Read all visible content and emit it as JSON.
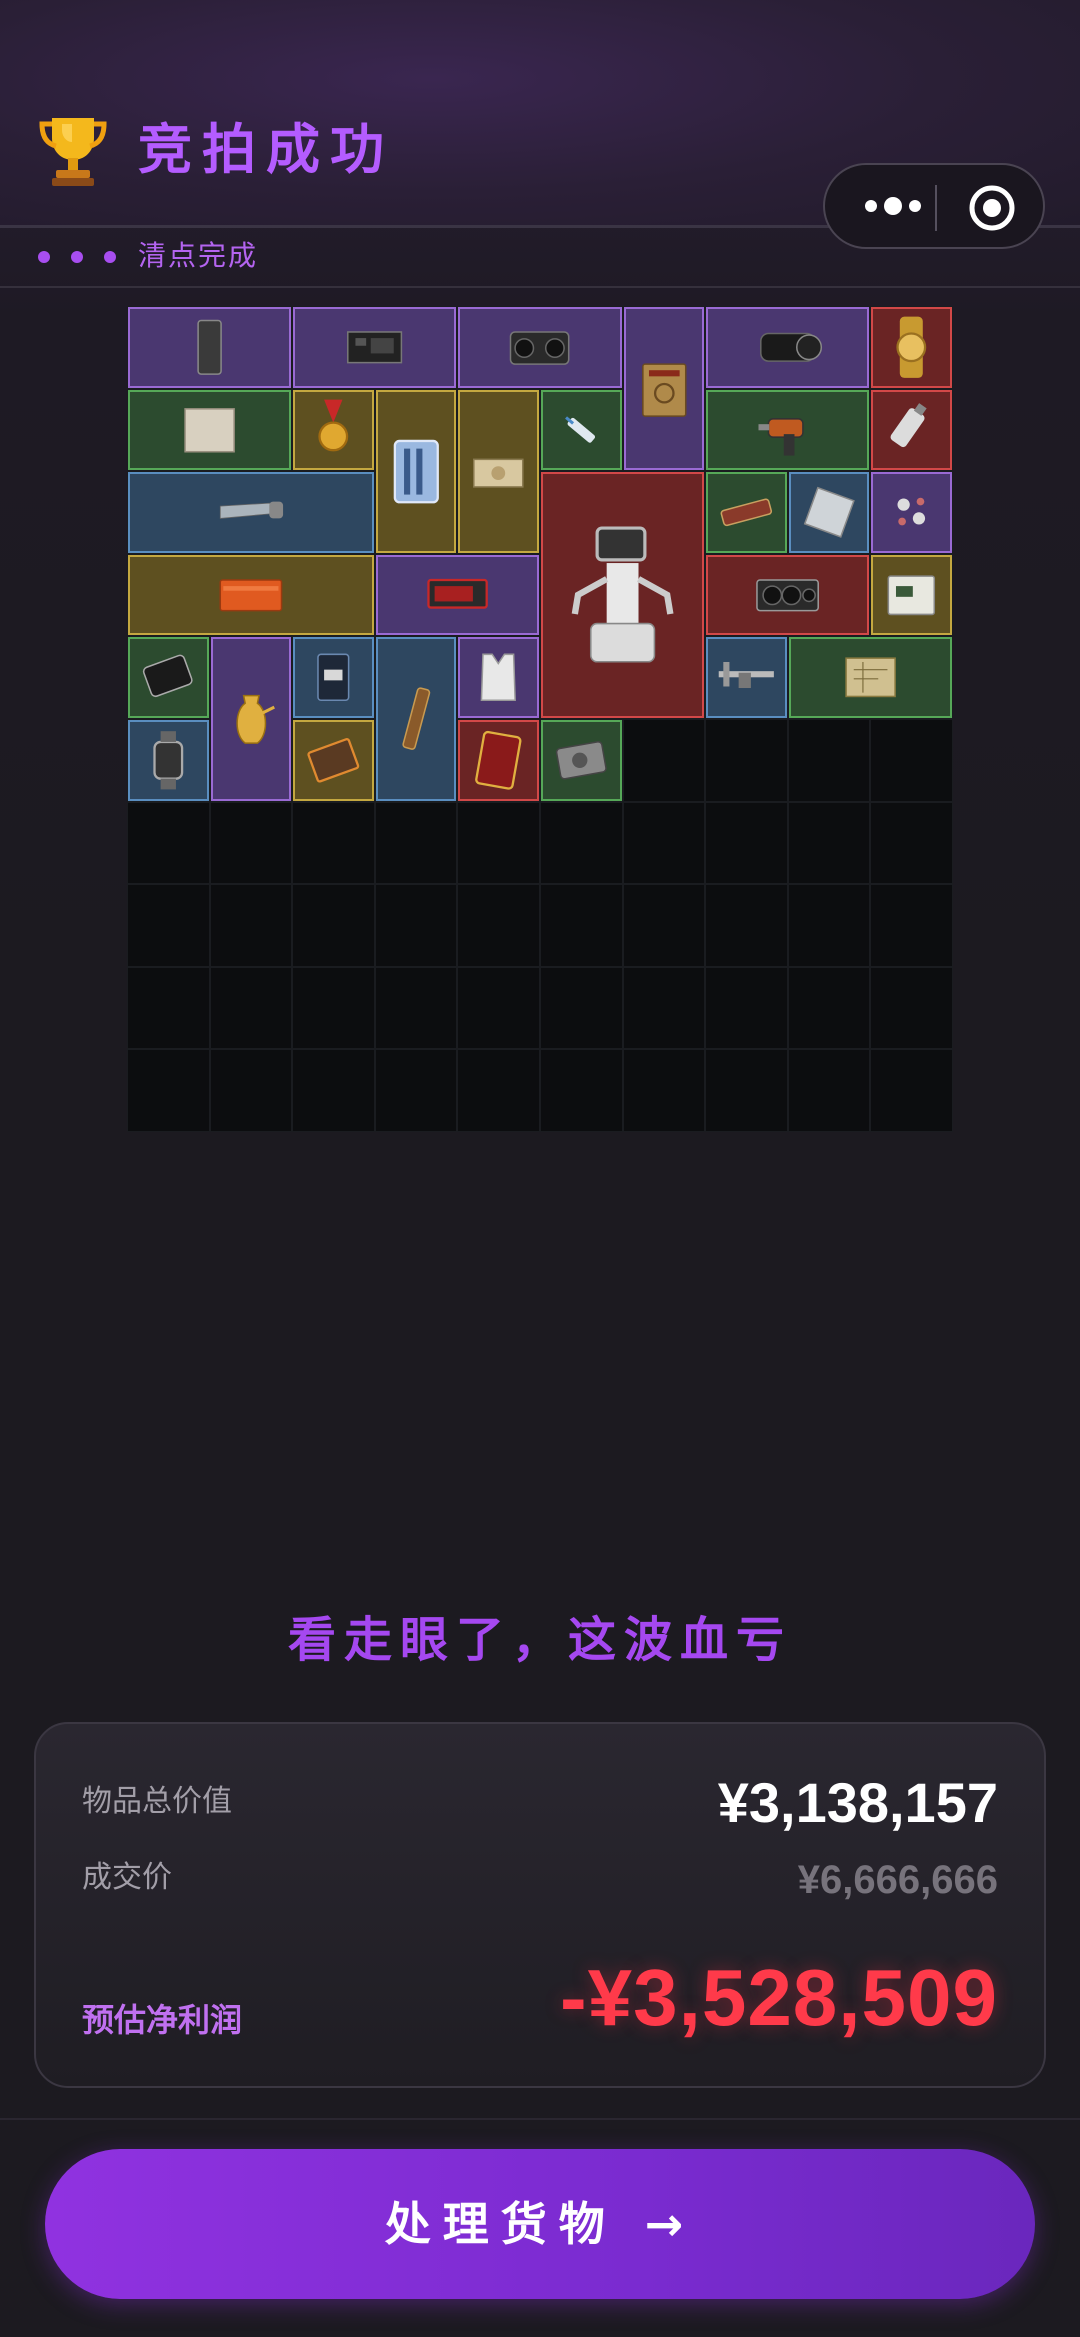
{
  "header": {
    "title": "竞拍成功",
    "status_label": "清点完成"
  },
  "verdict": "看走眼了，这波血亏",
  "summary": {
    "total_label": "物品总价值",
    "total_value": "¥3,138,157",
    "deal_label": "成交价",
    "deal_value": "¥6,666,666",
    "profit_label": "预估净利润",
    "profit_value": "-¥3,528,509"
  },
  "action_button": {
    "label": "处理货物 →"
  },
  "grid": {
    "columns": 10,
    "rows": 10,
    "items": [
      {
        "name": "slate-item",
        "rarity": "purple",
        "col": 0,
        "row": 0,
        "w": 2,
        "h": 1
      },
      {
        "name": "circuit-board-item",
        "rarity": "purple",
        "col": 2,
        "row": 0,
        "w": 2,
        "h": 1
      },
      {
        "name": "boombox-item",
        "rarity": "purple",
        "col": 4,
        "row": 0,
        "w": 2,
        "h": 1
      },
      {
        "name": "manual-book-item",
        "rarity": "purple",
        "col": 6,
        "row": 0,
        "w": 1,
        "h": 2
      },
      {
        "name": "camera-lens-item",
        "rarity": "purple",
        "col": 7,
        "row": 0,
        "w": 2,
        "h": 1
      },
      {
        "name": "gold-watch-item",
        "rarity": "red",
        "col": 9,
        "row": 0,
        "w": 1,
        "h": 1
      },
      {
        "name": "paper-sheet-item",
        "rarity": "green",
        "col": 0,
        "row": 1,
        "w": 2,
        "h": 1
      },
      {
        "name": "medal-item",
        "rarity": "gold",
        "col": 2,
        "row": 1,
        "w": 1,
        "h": 1
      },
      {
        "name": "tool-case-item",
        "rarity": "gold",
        "col": 3,
        "row": 1,
        "w": 1,
        "h": 2
      },
      {
        "name": "banknotes-item",
        "rarity": "gold",
        "col": 4,
        "row": 1,
        "w": 1,
        "h": 2
      },
      {
        "name": "syringe-item",
        "rarity": "green",
        "col": 5,
        "row": 1,
        "w": 1,
        "h": 1
      },
      {
        "name": "power-drill-item",
        "rarity": "green",
        "col": 7,
        "row": 1,
        "w": 2,
        "h": 1
      },
      {
        "name": "usb-drive-item",
        "rarity": "red",
        "col": 9,
        "row": 1,
        "w": 1,
        "h": 1
      },
      {
        "name": "saw-item",
        "rarity": "blue",
        "col": 0,
        "row": 2,
        "w": 3,
        "h": 1
      },
      {
        "name": "robot-item",
        "rarity": "red",
        "col": 5,
        "row": 2,
        "w": 2,
        "h": 3
      },
      {
        "name": "snack-bar-item",
        "rarity": "green",
        "col": 7,
        "row": 2,
        "w": 1,
        "h": 1
      },
      {
        "name": "cpu-chip-item",
        "rarity": "blue",
        "col": 8,
        "row": 2,
        "w": 1,
        "h": 1
      },
      {
        "name": "earrings-item",
        "rarity": "purple",
        "col": 9,
        "row": 2,
        "w": 1,
        "h": 1
      },
      {
        "name": "orange-crate-item",
        "rarity": "gold",
        "col": 0,
        "row": 3,
        "w": 3,
        "h": 1
      },
      {
        "name": "red-gpu-item",
        "rarity": "purple",
        "col": 3,
        "row": 3,
        "w": 2,
        "h": 1
      },
      {
        "name": "graphics-card-item",
        "rarity": "red",
        "col": 7,
        "row": 3,
        "w": 2,
        "h": 1
      },
      {
        "name": "plc-module-item",
        "rarity": "gold",
        "col": 9,
        "row": 3,
        "w": 1,
        "h": 1
      },
      {
        "name": "hard-drive-item",
        "rarity": "green",
        "col": 0,
        "row": 4,
        "w": 1,
        "h": 1
      },
      {
        "name": "golden-ewer-item",
        "rarity": "purple",
        "col": 1,
        "row": 4,
        "w": 1,
        "h": 2
      },
      {
        "name": "coffee-bag-item",
        "rarity": "blue",
        "col": 2,
        "row": 4,
        "w": 1,
        "h": 1
      },
      {
        "name": "spyglass-item",
        "rarity": "blue",
        "col": 3,
        "row": 4,
        "w": 1,
        "h": 2
      },
      {
        "name": "vest-item",
        "rarity": "purple",
        "col": 4,
        "row": 4,
        "w": 1,
        "h": 1
      },
      {
        "name": "caliper-item",
        "rarity": "blue",
        "col": 7,
        "row": 4,
        "w": 1,
        "h": 1
      },
      {
        "name": "blueprint-item",
        "rarity": "green",
        "col": 8,
        "row": 4,
        "w": 2,
        "h": 1
      },
      {
        "name": "smartwatch-item",
        "rarity": "blue",
        "col": 0,
        "row": 5,
        "w": 1,
        "h": 1
      },
      {
        "name": "chocolate-item",
        "rarity": "gold",
        "col": 2,
        "row": 5,
        "w": 1,
        "h": 1
      },
      {
        "name": "card-item",
        "rarity": "red",
        "col": 4,
        "row": 5,
        "w": 1,
        "h": 1
      },
      {
        "name": "disk-drive-item",
        "rarity": "green",
        "col": 5,
        "row": 5,
        "w": 1,
        "h": 1
      }
    ]
  },
  "colors": {
    "accent": "#b45cff",
    "loss": "#ff3a4a",
    "rarity": {
      "purple": "#9a6ad4",
      "red": "#d24848",
      "green": "#56a858",
      "blue": "#5a8ec0",
      "gold": "#c4a840"
    }
  }
}
